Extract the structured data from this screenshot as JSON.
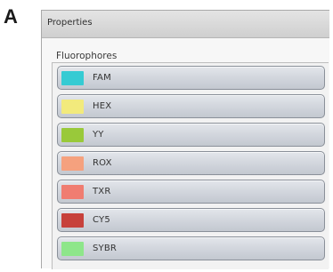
{
  "figure_label": "A",
  "window": {
    "title": "Properties"
  },
  "fluorophores": {
    "section_label": "Fluorophores",
    "items": [
      {
        "label": "FAM",
        "color": "#35cbd3"
      },
      {
        "label": "HEX",
        "color": "#f2ea7c"
      },
      {
        "label": "YY",
        "color": "#99c93a"
      },
      {
        "label": "ROX",
        "color": "#f5a17e"
      },
      {
        "label": "TXR",
        "color": "#f07d71"
      },
      {
        "label": "CY5",
        "color": "#c7413b"
      },
      {
        "label": "SYBR",
        "color": "#8ee68a"
      }
    ]
  }
}
